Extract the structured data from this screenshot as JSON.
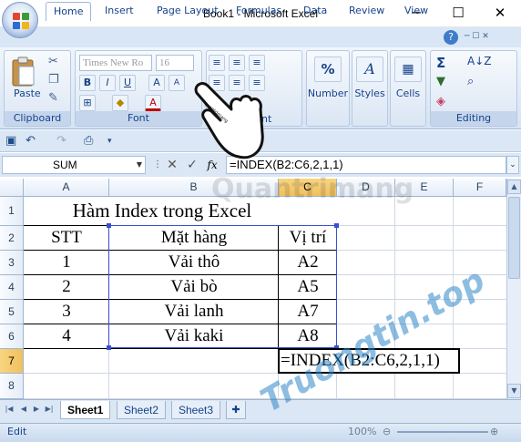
{
  "window": {
    "title": "Book1 - Microsoft Excel",
    "minimize": "─",
    "maximize": "☐",
    "close": "✕"
  },
  "tabs": [
    "Home",
    "Insert",
    "Page Layout",
    "Formulas",
    "Data",
    "Review",
    "View"
  ],
  "ribbon": {
    "clipboard": {
      "label": "Clipboard",
      "paste": "Paste"
    },
    "font": {
      "label": "Font",
      "name": "Times New Ro",
      "size": "16",
      "bold": "B",
      "italic": "I",
      "underline": "U",
      "color_a": "A"
    },
    "alignment": {
      "label": "nt"
    },
    "number": {
      "label": "Number",
      "icon": "%"
    },
    "styles": {
      "label": "Styles"
    },
    "cells": {
      "label": "Cells"
    },
    "editing": {
      "label": "Editing",
      "sum": "Σ"
    }
  },
  "formula_bar": {
    "name_box": "SUM",
    "fx": "fx",
    "formula": "=INDEX(B2:C6,2,1,1)"
  },
  "grid": {
    "columns": [
      "A",
      "B",
      "C",
      "D",
      "E",
      "F"
    ],
    "rows": [
      "1",
      "2",
      "3",
      "4",
      "5",
      "6",
      "7",
      "8"
    ],
    "title": "Hàm Index trong Excel",
    "headers": {
      "stt": "STT",
      "item": "Mặt hàng",
      "pos": "Vị trí"
    },
    "data": [
      {
        "stt": "1",
        "item": "Vải thô",
        "pos": "A2"
      },
      {
        "stt": "2",
        "item": "Vải bò",
        "pos": "A5"
      },
      {
        "stt": "3",
        "item": "Vải lanh",
        "pos": "A7"
      },
      {
        "stt": "4",
        "item": "Vải kaki",
        "pos": "A8"
      }
    ],
    "editing_cell": "=INDEX(B2:C6,2,1,1)"
  },
  "sheets": [
    "Sheet1",
    "Sheet2",
    "Sheet3"
  ],
  "status": {
    "mode": "Edit",
    "zoom": "100%"
  },
  "watermark": {
    "primary": "Quantrimang",
    "secondary": "Truongtin.top"
  },
  "colors": {
    "accent": "#15428b",
    "tab_bg": "#d9e6f5",
    "selected_header": "#f1c05c",
    "watermark_orange": "#e8541c",
    "watermark_blue": "#2f86c8"
  }
}
